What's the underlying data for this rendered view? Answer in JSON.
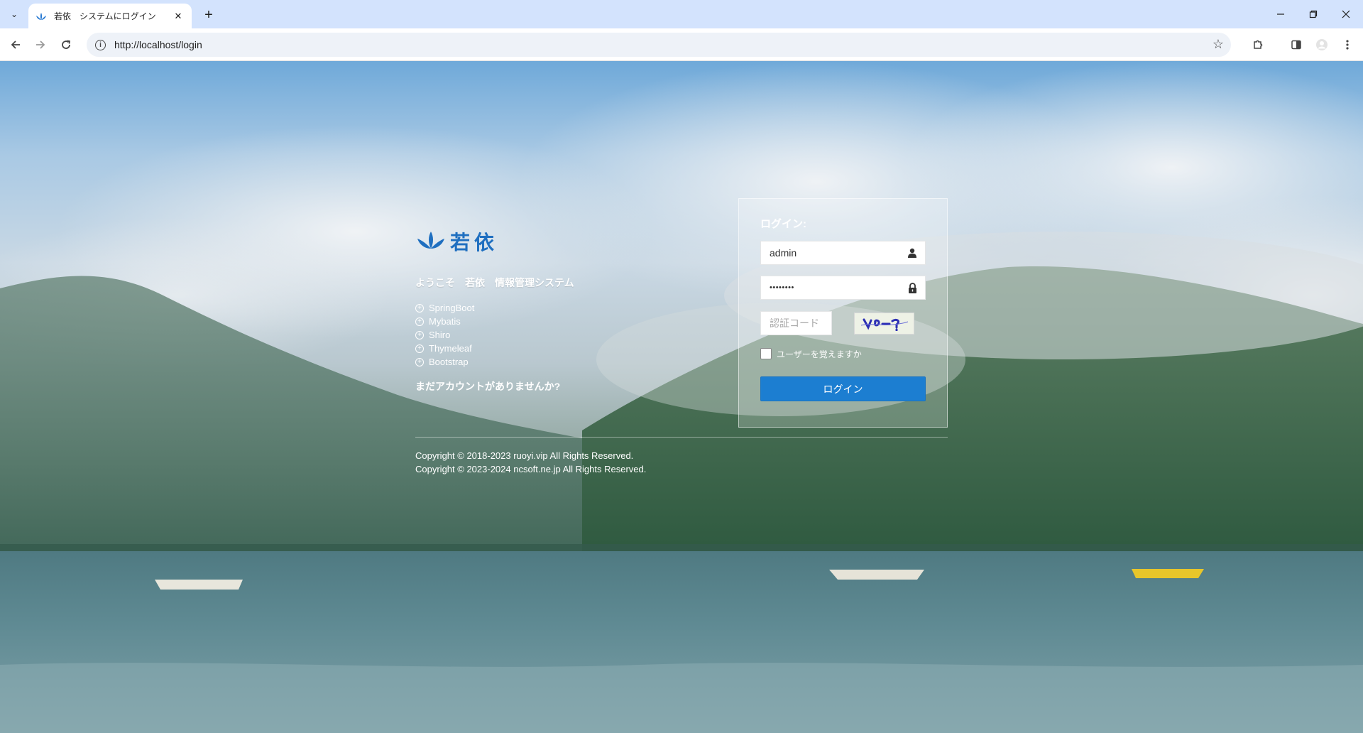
{
  "browser": {
    "tab_title": "若依　システムにログイン",
    "url": "http://localhost/login",
    "close_tab": "✕",
    "new_tab": "+"
  },
  "login": {
    "logo_text": "若依",
    "welcome": "ようこそ　若依　情報管理システム",
    "tech_items": [
      "SpringBoot",
      "Mybatis",
      "Shiro",
      "Thymeleaf",
      "Bootstrap"
    ],
    "no_account": "まだアカウントがありませんか?",
    "heading": "ログイン:",
    "username_value": "admin",
    "password_value": "••••••••",
    "captcha_placeholder": "認証コード",
    "remember_label": "ユーザーを覚えますか",
    "login_button": "ログイン"
  },
  "footer": {
    "line1": "Copyright © 2018-2023 ruoyi.vip All Rights Reserved.",
    "line2": "Copyright © 2023-2024 ncsoft.ne.jp All Rights Reserved."
  },
  "icons": {
    "tab_menu": "chevron-down-icon",
    "favicon": "lotus-icon",
    "back": "arrow-left-icon",
    "forward": "arrow-right-icon",
    "reload": "reload-icon",
    "site_info": "info-icon",
    "bookmark": "star-icon",
    "extensions": "puzzle-icon",
    "side_panel": "side-panel-icon",
    "profile": "profile-icon",
    "menu": "kebab-menu-icon",
    "username": "user-icon",
    "password": "lock-icon"
  },
  "colors": {
    "login_button": "#1c7ed1",
    "logo": "#1f6fc0",
    "tabstrip": "#d3e3fd"
  }
}
